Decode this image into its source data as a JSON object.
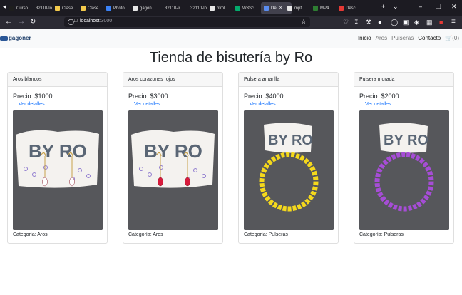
{
  "browser": {
    "tabs": [
      {
        "label": "Cursos",
        "color": "#1e1e1e"
      },
      {
        "label": "32110-lo",
        "color": "#1c1b22"
      },
      {
        "label": "Clase",
        "color": "#f2c94c"
      },
      {
        "label": "Clase",
        "color": "#f2c94c"
      },
      {
        "label": "Photo",
        "color": "#3b82f6"
      },
      {
        "label": "gagon",
        "color": "#e6e6e6"
      },
      {
        "label": "32110-lo",
        "color": "#1c1b22"
      },
      {
        "label": "32110-lo",
        "color": "#1c1b22"
      },
      {
        "label": "html",
        "color": "#e6e6e6"
      },
      {
        "label": "W3Sc",
        "color": "#04aa6d"
      },
      {
        "label": "De",
        "color": "#5b8def"
      },
      {
        "label": "mpf",
        "color": "#e6e6e6"
      },
      {
        "label": "MP4",
        "color": "#2e7d32"
      },
      {
        "label": "Desc",
        "color": "#e53935"
      }
    ],
    "active_tab_index": 10,
    "url_host": "localhost",
    "url_port": ":3000"
  },
  "navbar": {
    "brand": "gagoner",
    "links": [
      {
        "label": "Inicio",
        "active": true
      },
      {
        "label": "Aros",
        "active": false
      },
      {
        "label": "Pulseras",
        "active": false
      },
      {
        "label": "Contacto",
        "active": true
      }
    ],
    "cart_label": "(0)"
  },
  "page": {
    "title": "Tienda de bisutería by Ro",
    "details_label": "Ver detalles"
  },
  "products": [
    {
      "name": "Aros blancos",
      "price": "Precio: $1000",
      "category": "Categoría: Aros",
      "accent": "#ffffff",
      "type": "earrings"
    },
    {
      "name": "Aros corazones rojos",
      "price": "Precio: $3000",
      "category": "Categoría: Aros",
      "accent": "#d81b3c",
      "type": "earrings"
    },
    {
      "name": "Pulsera amarilla",
      "price": "Precio: $4000",
      "category": "Categoría: Pulseras",
      "accent": "#f4d81c",
      "type": "bracelet"
    },
    {
      "name": "Pulsera morada",
      "price": "Precio: $2000",
      "category": "Categoría: Pulseras",
      "accent": "#a64dd6",
      "type": "bracelet"
    }
  ]
}
